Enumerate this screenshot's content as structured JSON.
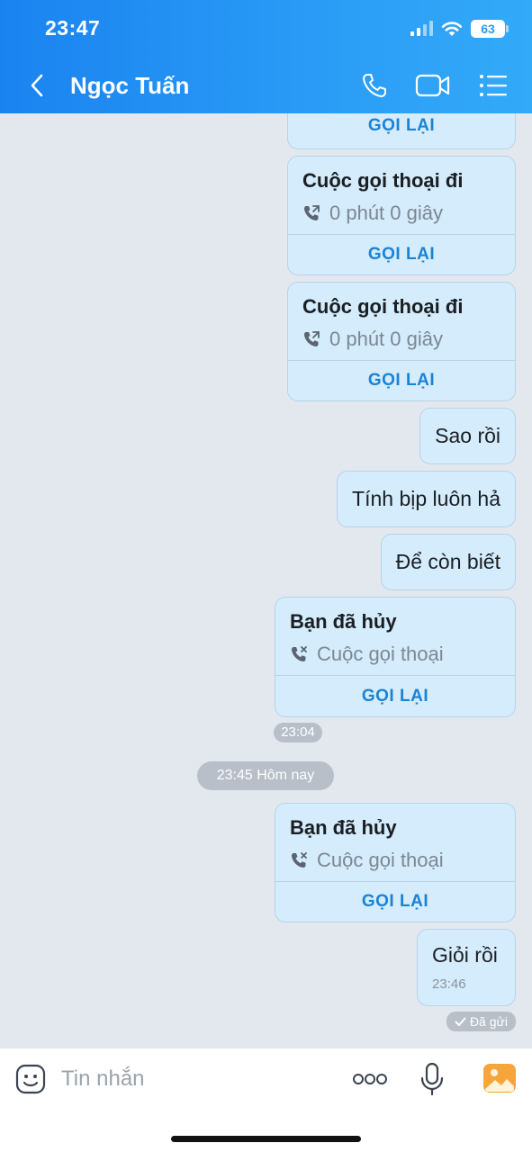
{
  "status_bar": {
    "time": "23:47",
    "battery": "63"
  },
  "header": {
    "contact_name": "Ngọc Tuấn"
  },
  "messages": {
    "call_card_0": {
      "button": "GỌI LẠI"
    },
    "call_card_1": {
      "title": "Cuộc gọi thoại đi",
      "subtitle": "0 phút 0 giây",
      "button": "GỌI LẠI"
    },
    "call_card_2": {
      "title": "Cuộc gọi thoại đi",
      "subtitle": "0 phút 0 giây",
      "button": "GỌI LẠI"
    },
    "text_1": "Sao rồi",
    "text_2": "Tính bịp luôn hả",
    "text_3": "Để còn biết",
    "call_card_3": {
      "title": "Bạn đã hủy",
      "subtitle": "Cuộc gọi thoại",
      "button": "GỌI LẠI"
    },
    "time_1": "23:04",
    "divider_time": "23:45 Hôm nay",
    "call_card_4": {
      "title": "Bạn đã hủy",
      "subtitle": "Cuộc gọi thoại",
      "button": "GỌI LẠI"
    },
    "text_4": "Giỏi rồi",
    "text_4_time": "23:46",
    "sent_status": "Đã gửi"
  },
  "composer": {
    "placeholder": "Tin nhắn"
  },
  "colors": {
    "header_start": "#1a83f0",
    "header_end": "#33aaf8",
    "bubble": "#d4ecfb",
    "accent": "#1a83d6",
    "background": "#e3e8ef"
  },
  "icons": [
    "back-icon",
    "phone-icon",
    "video-icon",
    "menu-icon",
    "sticker-icon",
    "more-icon",
    "microphone-icon",
    "image-icon",
    "outgoing-call-icon",
    "missed-call-icon",
    "check-icon"
  ]
}
